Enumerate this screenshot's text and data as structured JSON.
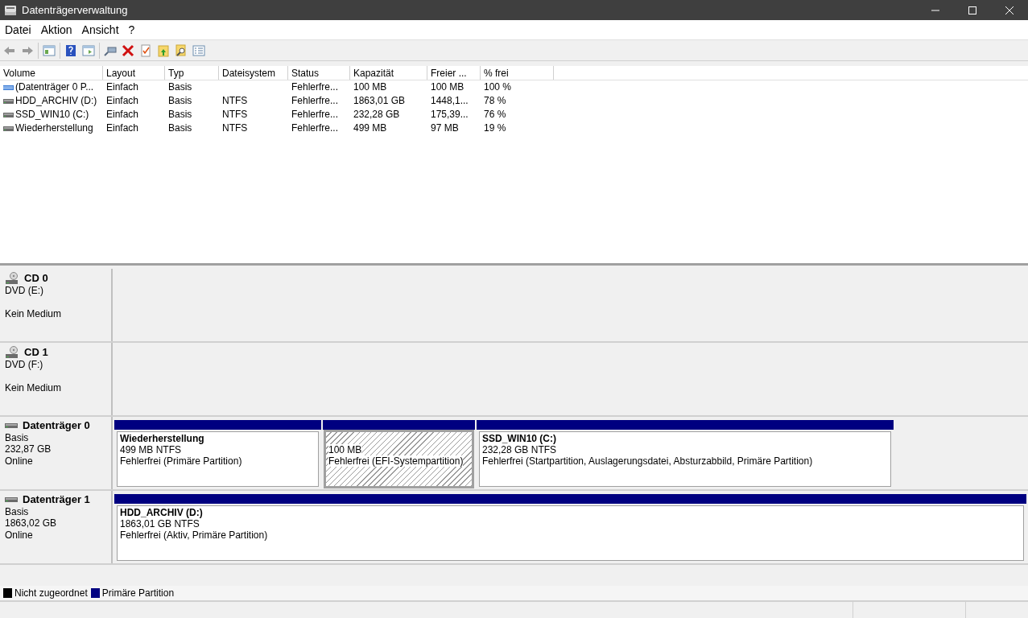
{
  "window": {
    "title": "Datenträgerverwaltung"
  },
  "menu": [
    "Datei",
    "Aktion",
    "Ansicht",
    "?"
  ],
  "table": {
    "columns": [
      "Volume",
      "Layout",
      "Typ",
      "Dateisystem",
      "Status",
      "Kapazität",
      "Freier ...",
      "% frei"
    ],
    "rows": [
      {
        "kind": "efi",
        "cells": [
          "(Datenträger 0 P...",
          "Einfach",
          "Basis",
          "",
          "Fehlerfre...",
          "100 MB",
          "100 MB",
          "100 %"
        ]
      },
      {
        "kind": "drive",
        "cells": [
          "HDD_ARCHIV (D:)",
          "Einfach",
          "Basis",
          "NTFS",
          "Fehlerfre...",
          "1863,01 GB",
          "1448,1...",
          "78 %"
        ]
      },
      {
        "kind": "drive",
        "cells": [
          "SSD_WIN10 (C:)",
          "Einfach",
          "Basis",
          "NTFS",
          "Fehlerfre...",
          "232,28 GB",
          "175,39...",
          "76 %"
        ]
      },
      {
        "kind": "drive",
        "cells": [
          "Wiederherstellung",
          "Einfach",
          "Basis",
          "NTFS",
          "Fehlerfre...",
          "499 MB",
          "97 MB",
          "19 %"
        ]
      }
    ]
  },
  "disks": [
    {
      "kind": "cd",
      "name": "CD 0",
      "lines": [
        "DVD (E:)"
      ],
      "note": "Kein Medium"
    },
    {
      "kind": "cd",
      "name": "CD 1",
      "lines": [
        "DVD (F:)"
      ],
      "note": "Kein Medium"
    },
    {
      "kind": "disk",
      "name": "Datenträger 0",
      "lines": [
        "Basis",
        "232,87 GB",
        "Online"
      ],
      "partitions": [
        {
          "kind": "primary",
          "name": "Wiederherstellung",
          "size": "499 MB NTFS",
          "status": "Fehlerfrei (Primäre Partition)"
        },
        {
          "kind": "efi",
          "size": "100 MB",
          "status": "Fehlerfrei (EFI-Systempartition)"
        },
        {
          "kind": "primary",
          "name": "SSD_WIN10  (C:)",
          "size": "232,28 GB NTFS",
          "status": "Fehlerfrei (Startpartition, Auslagerungsdatei, Absturzabbild, Primäre Partition)"
        }
      ]
    },
    {
      "kind": "disk",
      "name": "Datenträger 1",
      "lines": [
        "Basis",
        "1863,02 GB",
        "Online"
      ],
      "partitions": [
        {
          "kind": "primary",
          "name": "HDD_ARCHIV  (D:)",
          "size": "1863,01 GB NTFS",
          "status": "Fehlerfrei (Aktiv, Primäre Partition)"
        }
      ]
    }
  ],
  "legend": [
    {
      "label": "Nicht zugeordnet",
      "color": "#000000"
    },
    {
      "label": "Primäre Partition",
      "color": "#000080"
    }
  ]
}
